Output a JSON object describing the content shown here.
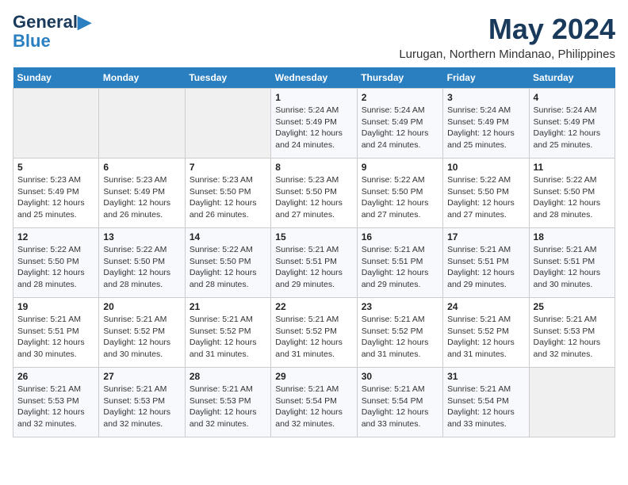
{
  "header": {
    "logo_line1": "General",
    "logo_line2": "Blue",
    "month": "May 2024",
    "location": "Lurugan, Northern Mindanao, Philippines"
  },
  "weekdays": [
    "Sunday",
    "Monday",
    "Tuesday",
    "Wednesday",
    "Thursday",
    "Friday",
    "Saturday"
  ],
  "weeks": [
    [
      {
        "day": "",
        "sunrise": "",
        "sunset": "",
        "daylight": ""
      },
      {
        "day": "",
        "sunrise": "",
        "sunset": "",
        "daylight": ""
      },
      {
        "day": "",
        "sunrise": "",
        "sunset": "",
        "daylight": ""
      },
      {
        "day": "1",
        "sunrise": "5:24 AM",
        "sunset": "5:49 PM",
        "daylight": "12 hours and 24 minutes."
      },
      {
        "day": "2",
        "sunrise": "5:24 AM",
        "sunset": "5:49 PM",
        "daylight": "12 hours and 24 minutes."
      },
      {
        "day": "3",
        "sunrise": "5:24 AM",
        "sunset": "5:49 PM",
        "daylight": "12 hours and 25 minutes."
      },
      {
        "day": "4",
        "sunrise": "5:24 AM",
        "sunset": "5:49 PM",
        "daylight": "12 hours and 25 minutes."
      }
    ],
    [
      {
        "day": "5",
        "sunrise": "5:23 AM",
        "sunset": "5:49 PM",
        "daylight": "12 hours and 25 minutes."
      },
      {
        "day": "6",
        "sunrise": "5:23 AM",
        "sunset": "5:49 PM",
        "daylight": "12 hours and 26 minutes."
      },
      {
        "day": "7",
        "sunrise": "5:23 AM",
        "sunset": "5:50 PM",
        "daylight": "12 hours and 26 minutes."
      },
      {
        "day": "8",
        "sunrise": "5:23 AM",
        "sunset": "5:50 PM",
        "daylight": "12 hours and 27 minutes."
      },
      {
        "day": "9",
        "sunrise": "5:22 AM",
        "sunset": "5:50 PM",
        "daylight": "12 hours and 27 minutes."
      },
      {
        "day": "10",
        "sunrise": "5:22 AM",
        "sunset": "5:50 PM",
        "daylight": "12 hours and 27 minutes."
      },
      {
        "day": "11",
        "sunrise": "5:22 AM",
        "sunset": "5:50 PM",
        "daylight": "12 hours and 28 minutes."
      }
    ],
    [
      {
        "day": "12",
        "sunrise": "5:22 AM",
        "sunset": "5:50 PM",
        "daylight": "12 hours and 28 minutes."
      },
      {
        "day": "13",
        "sunrise": "5:22 AM",
        "sunset": "5:50 PM",
        "daylight": "12 hours and 28 minutes."
      },
      {
        "day": "14",
        "sunrise": "5:22 AM",
        "sunset": "5:50 PM",
        "daylight": "12 hours and 28 minutes."
      },
      {
        "day": "15",
        "sunrise": "5:21 AM",
        "sunset": "5:51 PM",
        "daylight": "12 hours and 29 minutes."
      },
      {
        "day": "16",
        "sunrise": "5:21 AM",
        "sunset": "5:51 PM",
        "daylight": "12 hours and 29 minutes."
      },
      {
        "day": "17",
        "sunrise": "5:21 AM",
        "sunset": "5:51 PM",
        "daylight": "12 hours and 29 minutes."
      },
      {
        "day": "18",
        "sunrise": "5:21 AM",
        "sunset": "5:51 PM",
        "daylight": "12 hours and 30 minutes."
      }
    ],
    [
      {
        "day": "19",
        "sunrise": "5:21 AM",
        "sunset": "5:51 PM",
        "daylight": "12 hours and 30 minutes."
      },
      {
        "day": "20",
        "sunrise": "5:21 AM",
        "sunset": "5:52 PM",
        "daylight": "12 hours and 30 minutes."
      },
      {
        "day": "21",
        "sunrise": "5:21 AM",
        "sunset": "5:52 PM",
        "daylight": "12 hours and 31 minutes."
      },
      {
        "day": "22",
        "sunrise": "5:21 AM",
        "sunset": "5:52 PM",
        "daylight": "12 hours and 31 minutes."
      },
      {
        "day": "23",
        "sunrise": "5:21 AM",
        "sunset": "5:52 PM",
        "daylight": "12 hours and 31 minutes."
      },
      {
        "day": "24",
        "sunrise": "5:21 AM",
        "sunset": "5:52 PM",
        "daylight": "12 hours and 31 minutes."
      },
      {
        "day": "25",
        "sunrise": "5:21 AM",
        "sunset": "5:53 PM",
        "daylight": "12 hours and 32 minutes."
      }
    ],
    [
      {
        "day": "26",
        "sunrise": "5:21 AM",
        "sunset": "5:53 PM",
        "daylight": "12 hours and 32 minutes."
      },
      {
        "day": "27",
        "sunrise": "5:21 AM",
        "sunset": "5:53 PM",
        "daylight": "12 hours and 32 minutes."
      },
      {
        "day": "28",
        "sunrise": "5:21 AM",
        "sunset": "5:53 PM",
        "daylight": "12 hours and 32 minutes."
      },
      {
        "day": "29",
        "sunrise": "5:21 AM",
        "sunset": "5:54 PM",
        "daylight": "12 hours and 32 minutes."
      },
      {
        "day": "30",
        "sunrise": "5:21 AM",
        "sunset": "5:54 PM",
        "daylight": "12 hours and 33 minutes."
      },
      {
        "day": "31",
        "sunrise": "5:21 AM",
        "sunset": "5:54 PM",
        "daylight": "12 hours and 33 minutes."
      },
      {
        "day": "",
        "sunrise": "",
        "sunset": "",
        "daylight": ""
      }
    ]
  ],
  "labels": {
    "sunrise_prefix": "Sunrise: ",
    "sunset_prefix": "Sunset: ",
    "daylight_prefix": "Daylight: "
  }
}
